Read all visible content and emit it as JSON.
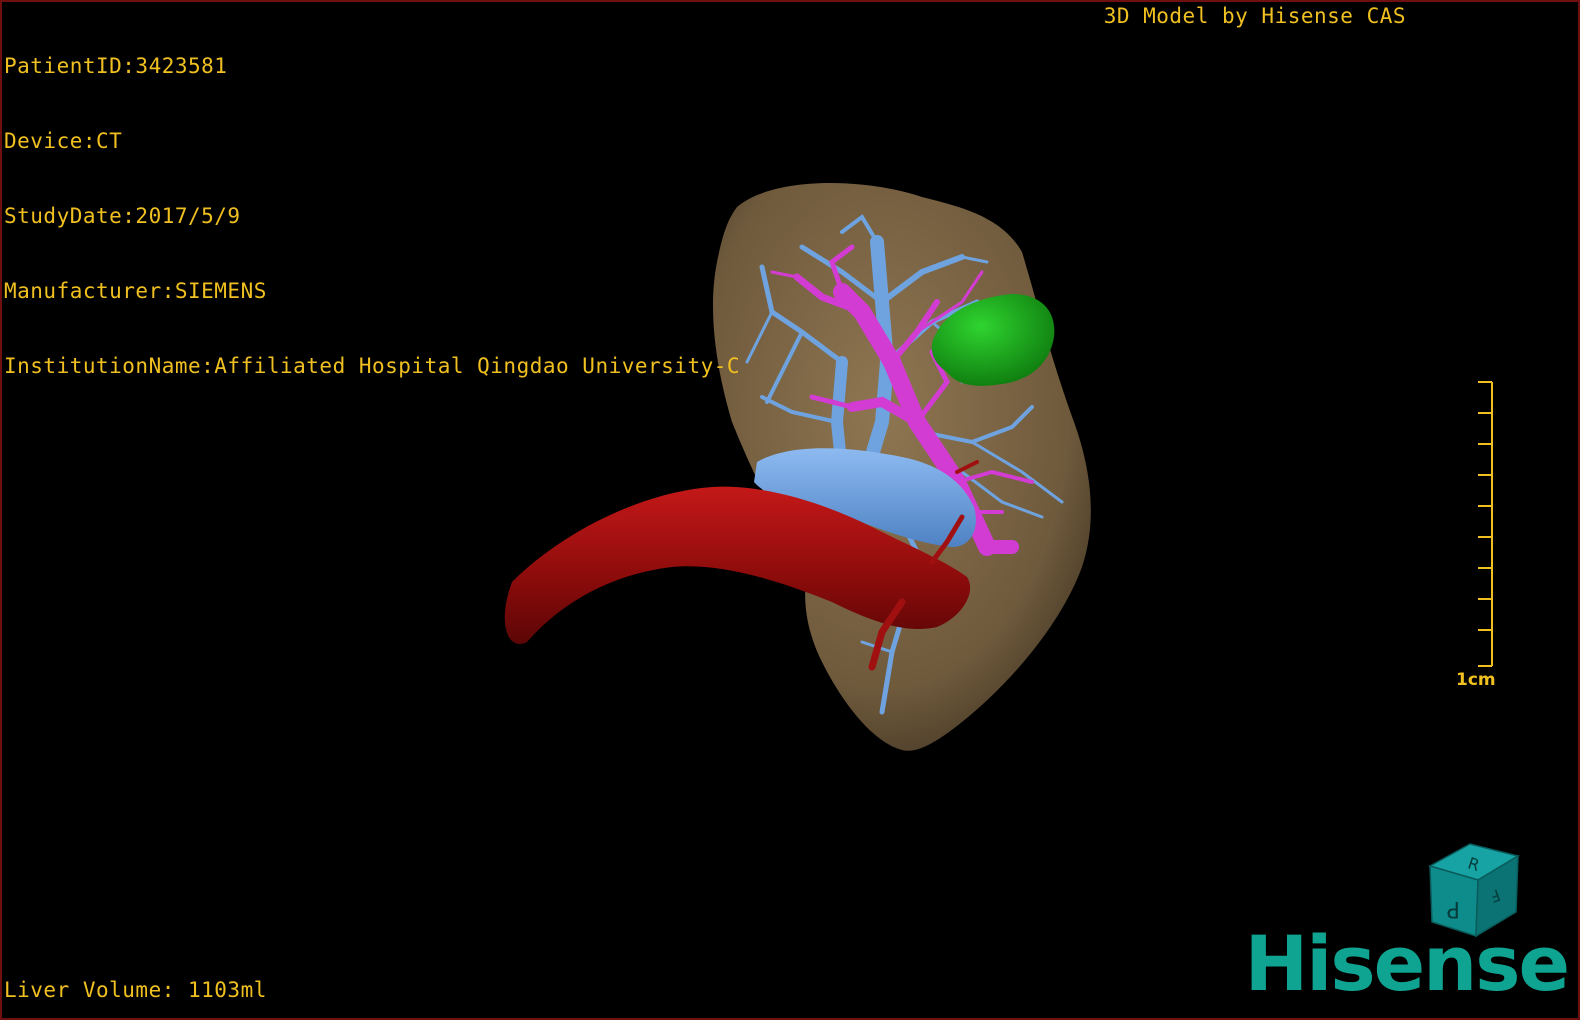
{
  "overlay": {
    "patient_id": "PatientID:3423581",
    "device": "Device:CT",
    "study_date": "StudyDate:2017/5/9",
    "manufacturer": "Manufacturer:SIEMENS",
    "institution": "InstitutionName:Affiliated Hospital Qingdao University-C",
    "model_credit": "3D Model by Hisense CAS",
    "liver_volume": "Liver Volume: 1103ml"
  },
  "scale": {
    "label": "1cm",
    "ticks": 10
  },
  "orientation_cube": {
    "faces": [
      "R",
      "F",
      "P"
    ],
    "color": "#0e8c8c"
  },
  "brand": {
    "logo_text": "Hisense",
    "color": "#0fa391"
  },
  "colors": {
    "overlay_text": "#f0c020",
    "liver": "#7d6646",
    "hepatic_vein": "#6fa3df",
    "portal_vein": "#d23cd2",
    "artery": "#a01010",
    "tumor": "#1fb31f",
    "border": "#6e1010"
  }
}
